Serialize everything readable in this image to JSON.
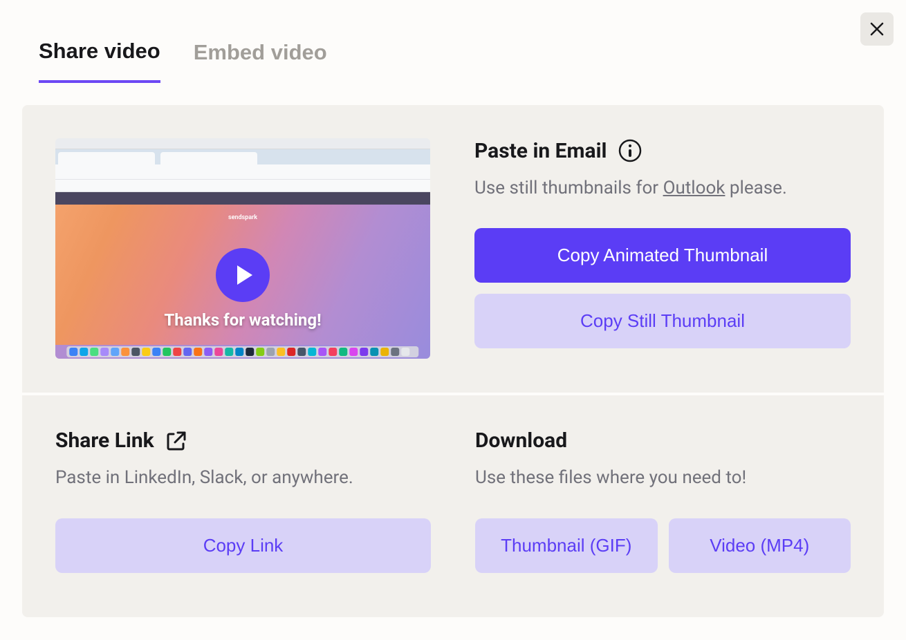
{
  "tabs": {
    "share": "Share video",
    "embed": "Embed video"
  },
  "thumbnail": {
    "overlay_text": "Thanks for watching!",
    "logo_text": "sendspark"
  },
  "email": {
    "title": "Paste in Email",
    "subtitle_prefix": "Use still thumbnails for ",
    "subtitle_link": "Outlook",
    "subtitle_suffix": " please.",
    "button_animated": "Copy Animated Thumbnail",
    "button_still": "Copy Still Thumbnail"
  },
  "shareLink": {
    "title": "Share Link",
    "subtitle": "Paste in LinkedIn, Slack, or anywhere.",
    "button_copy": "Copy Link"
  },
  "download": {
    "title": "Download",
    "subtitle": "Use these files where you need to!",
    "button_gif": "Thumbnail (GIF)",
    "button_mp4": "Video (MP4)"
  }
}
